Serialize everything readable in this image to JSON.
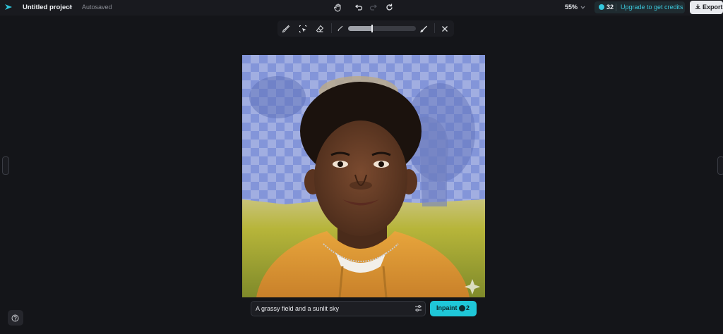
{
  "header": {
    "project_name": "Untitled project",
    "save_status": "Autosaved",
    "zoom": "55%",
    "credits": "32",
    "upgrade_label": "Upgrade to get credits",
    "export_label": "Export"
  },
  "toolbar": {
    "tools": [
      "brush-icon",
      "quick-select-icon",
      "eraser-icon"
    ],
    "brush_size_icon": "brush-size-small-icon",
    "brush_size_fraction": 0.34,
    "brush_size_large_icon": "brush-size-large-icon",
    "close_icon": "close-icon"
  },
  "prompt": {
    "value": "A grassy field and a sunlit sky",
    "settings_icon": "sliders-icon"
  },
  "inpaint": {
    "label": "Inpaint",
    "cost": "2"
  },
  "colors": {
    "accent": "#1fc7d8",
    "mask": "#7b8fe0",
    "background": "#141519"
  }
}
